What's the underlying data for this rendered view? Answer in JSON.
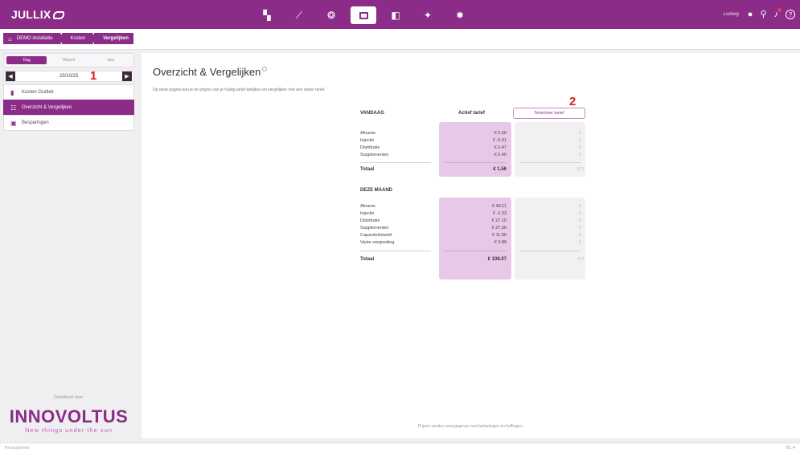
{
  "app": {
    "logo": "JULLIX",
    "user_name": "Ludwig"
  },
  "colors": {
    "brand": "#8a2c88",
    "active_col": "#e8c8e7",
    "marker": "#d81e1e"
  },
  "nav": [
    {
      "name": "dashboard-icon",
      "glyph": "▚"
    },
    {
      "name": "chart-icon",
      "glyph": "⟋"
    },
    {
      "name": "brain-icon",
      "glyph": "❂"
    },
    {
      "name": "cost-icon",
      "glyph": ""
    },
    {
      "name": "document-icon",
      "glyph": "◧"
    },
    {
      "name": "plug-icon",
      "glyph": "✦"
    },
    {
      "name": "gear-icon",
      "glyph": "✹"
    }
  ],
  "breadcrumb": {
    "home": "DEMO installatie",
    "middle": "Kosten",
    "current": "Vergelijken"
  },
  "sidebar": {
    "tabs": [
      "Dag",
      "Maand",
      "Jaar"
    ],
    "date": "23/10/25",
    "items": [
      {
        "label": "Kosten Grafiek",
        "icon": "bar-chart-icon"
      },
      {
        "label": "Overzicht & Vergelijken",
        "icon": "compare-icon"
      },
      {
        "label": "Besparingen",
        "icon": "savings-icon"
      }
    ],
    "sponsor_label": "Ontwikkeld door:",
    "brand": "INNOVOLTUS",
    "tagline": "New things under the sun"
  },
  "markers": [
    "1",
    "2"
  ],
  "main": {
    "title": "Overzicht & Vergelijken",
    "description": "Op deze pagina kan je de prijzen van je huidig tarief bekijken en vergelijken met een ander tarief.",
    "active_header": "Actief tarief",
    "select_button": "Selecteer tarief",
    "today": {
      "heading": "VANDAAG",
      "rows": [
        {
          "label": "Afname",
          "value": "€ 0.60",
          "other": "€ -"
        },
        {
          "label": "Injectie",
          "value": "€ -0.01",
          "other": "€ -"
        },
        {
          "label": "Distributie",
          "value": "€ 0.47",
          "other": "€ -"
        },
        {
          "label": "Supplementen",
          "value": "€ 0.40",
          "other": "€ -"
        }
      ],
      "total_label": "Totaal",
      "total_value": "€ 1.56",
      "total_other": "€ 0"
    },
    "month": {
      "heading": "DEZE MAAND",
      "rows": [
        {
          "label": "Afname",
          "value": "€ 40.11",
          "other": "€ -"
        },
        {
          "label": "Injectie",
          "value": "€ -2.33",
          "other": "€ -"
        },
        {
          "label": "Distributie",
          "value": "€ 27.10",
          "other": "€ -"
        },
        {
          "label": "Supplementen",
          "value": "€ 27.30",
          "other": "€ -"
        },
        {
          "label": "Capaciteitstarief",
          "value": "€ 11.00",
          "other": "€ -"
        },
        {
          "label": "Vaste vergoeding",
          "value": "€ 4.89",
          "other": "€ -"
        }
      ],
      "total_label": "Totaal",
      "total_value": "€ 108.07",
      "total_other": "€ 0"
    },
    "footnote": "Prijzen worden weergegeven met belastingen en heffingen."
  },
  "status": {
    "left": "Privacybeleid",
    "right": "NL ▾"
  }
}
